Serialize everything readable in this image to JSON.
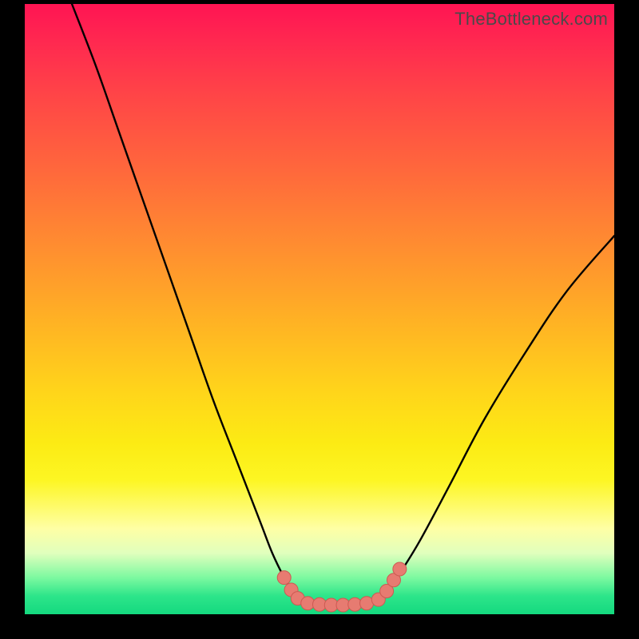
{
  "watermark": "TheBottleneck.com",
  "colors": {
    "frame": "#000000",
    "gradient_top": "#ff1453",
    "gradient_mid": "#ffd61a",
    "gradient_bottom": "#14d97f",
    "curve_stroke": "#000000",
    "marker_fill": "#e77b71",
    "marker_stroke": "#cc5a52"
  },
  "chart_data": {
    "type": "line",
    "title": "",
    "xlabel": "",
    "ylabel": "",
    "xlim": [
      0,
      100
    ],
    "ylim": [
      0,
      100
    ],
    "series": [
      {
        "name": "left_branch",
        "x": [
          8,
          12,
          16,
          20,
          24,
          28,
          32,
          36,
          40,
          42,
          44,
          45.5,
          46.5
        ],
        "y": [
          100,
          90,
          79,
          68,
          57,
          46,
          35,
          25,
          15,
          10,
          6,
          3.5,
          2
        ]
      },
      {
        "name": "floor",
        "x": [
          46.5,
          49,
          52,
          55,
          58,
          60
        ],
        "y": [
          2,
          1.6,
          1.5,
          1.5,
          1.6,
          2
        ]
      },
      {
        "name": "right_branch",
        "x": [
          60,
          61.5,
          63.5,
          67,
          72,
          78,
          85,
          92,
          100
        ],
        "y": [
          2,
          3.5,
          6.5,
          12,
          21,
          32,
          43,
          53,
          62
        ]
      }
    ],
    "markers": {
      "name": "bottom_dots",
      "points": [
        {
          "x": 44.0,
          "y": 6.0
        },
        {
          "x": 45.2,
          "y": 4.0
        },
        {
          "x": 46.3,
          "y": 2.6
        },
        {
          "x": 48.0,
          "y": 1.8
        },
        {
          "x": 50.0,
          "y": 1.6
        },
        {
          "x": 52.0,
          "y": 1.5
        },
        {
          "x": 54.0,
          "y": 1.5
        },
        {
          "x": 56.0,
          "y": 1.6
        },
        {
          "x": 58.0,
          "y": 1.8
        },
        {
          "x": 60.0,
          "y": 2.4
        },
        {
          "x": 61.4,
          "y": 3.8
        },
        {
          "x": 62.6,
          "y": 5.6
        },
        {
          "x": 63.6,
          "y": 7.4
        }
      ]
    }
  }
}
